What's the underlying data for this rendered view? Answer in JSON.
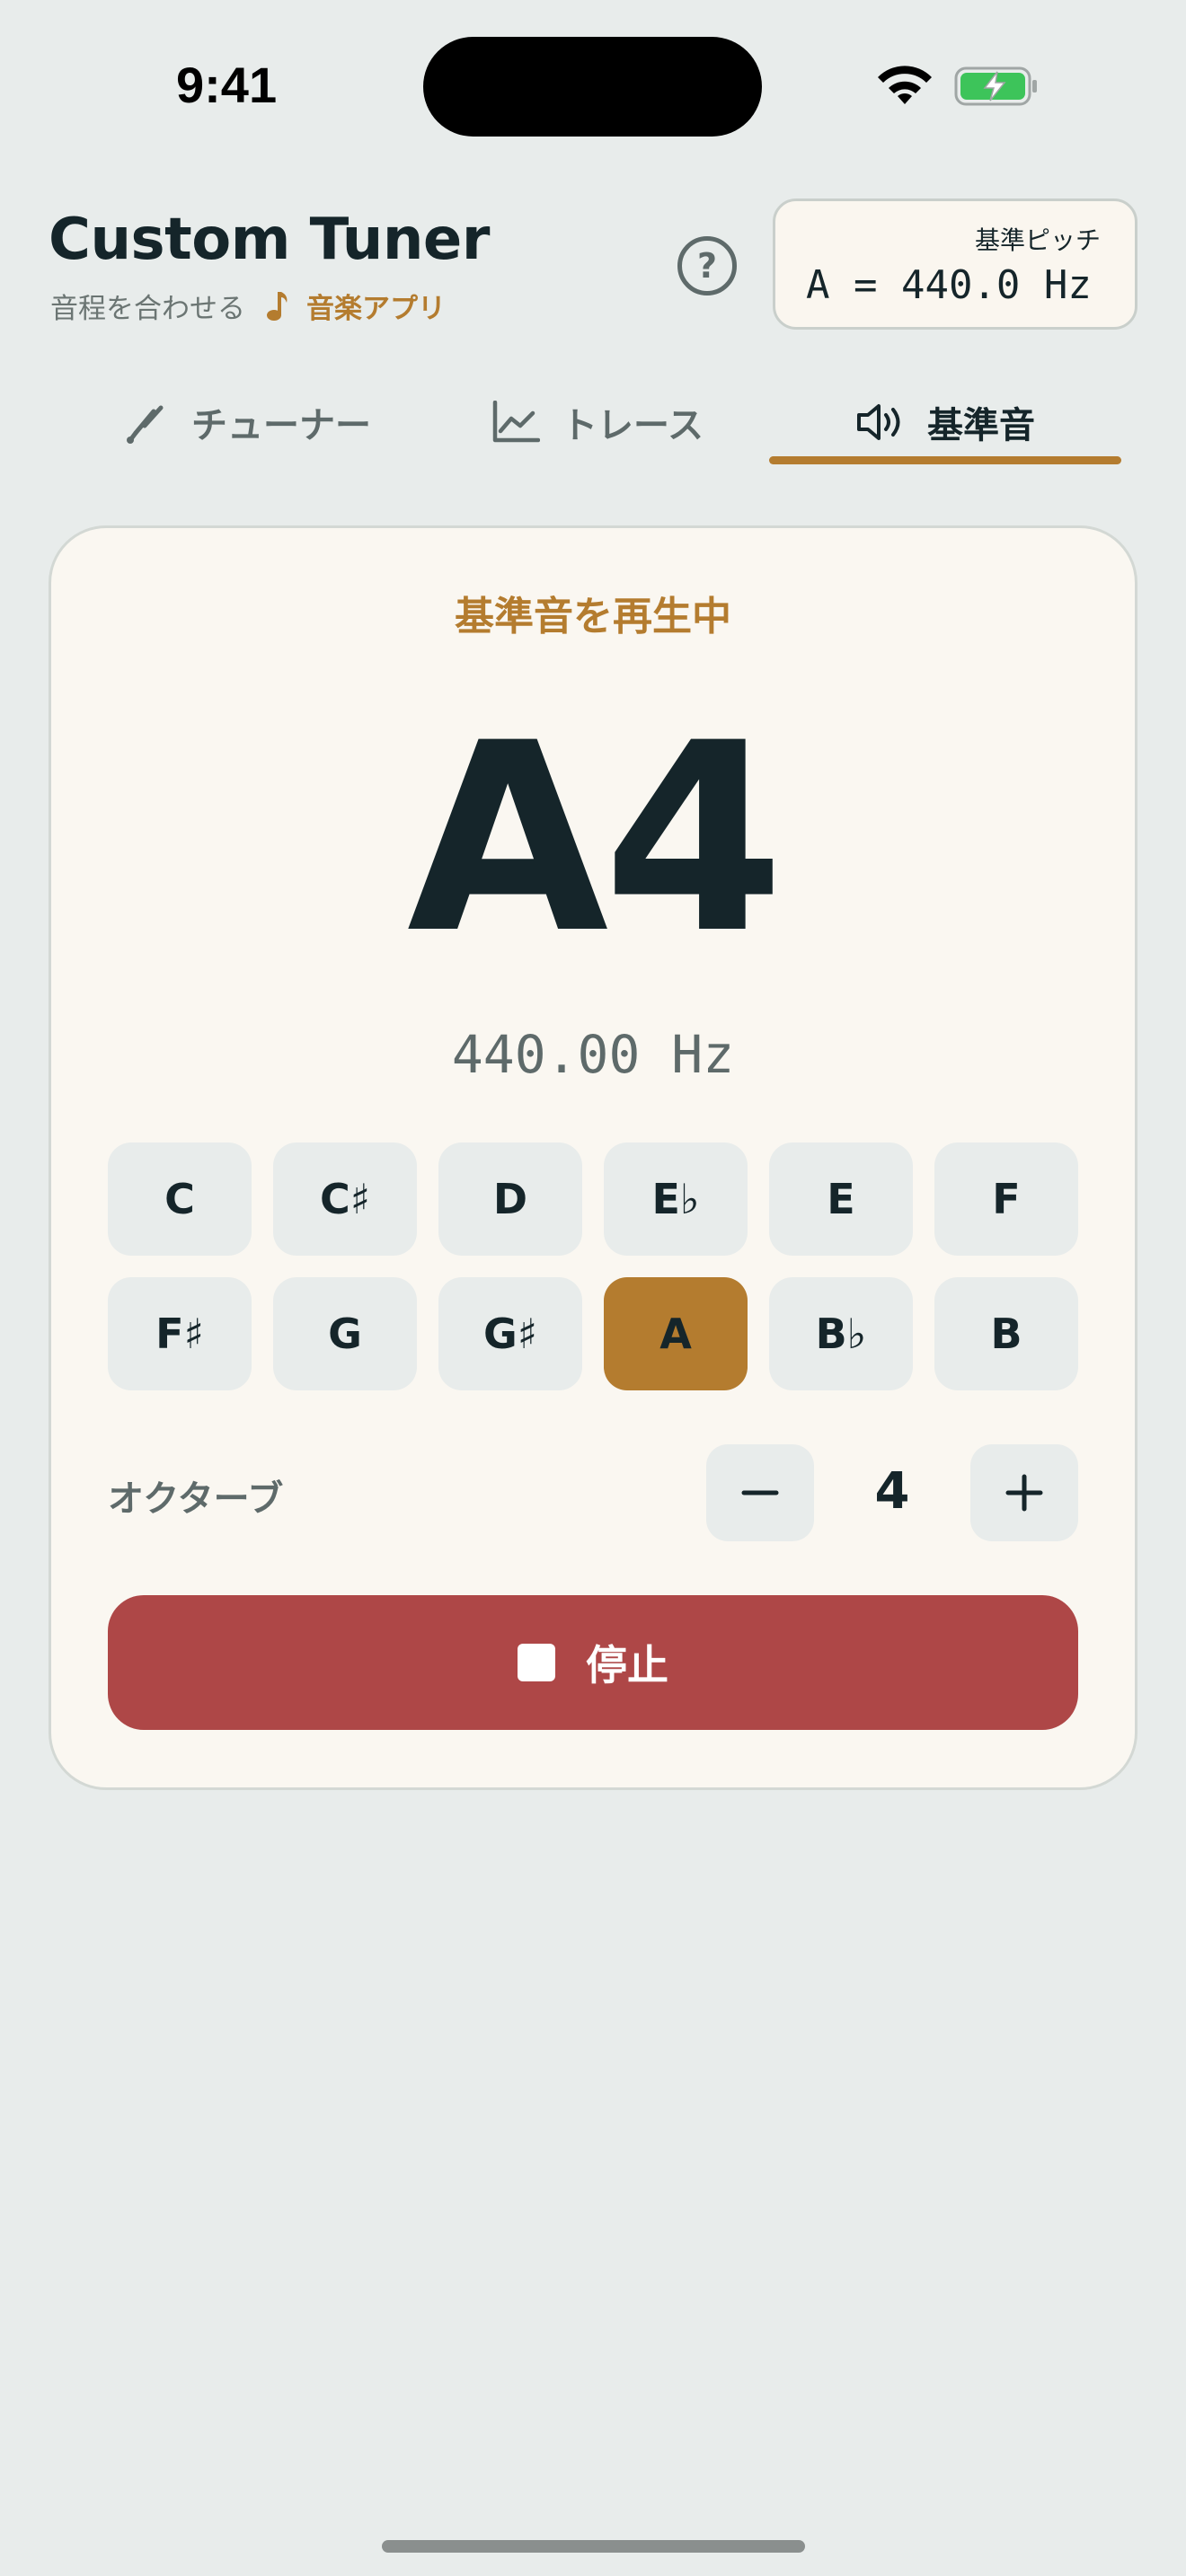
{
  "status_bar": {
    "time": "9:41"
  },
  "header": {
    "title": "Custom Tuner",
    "subtitle": "音程を合わせる",
    "category": "音楽アプリ",
    "help_label": "?"
  },
  "reference_pitch": {
    "label": "基準ピッチ",
    "value": "A = 440.0 Hz"
  },
  "tabs": [
    {
      "label": "チューナー",
      "icon": "tuning-fork-icon",
      "active": false
    },
    {
      "label": "トレース",
      "icon": "line-chart-icon",
      "active": false
    },
    {
      "label": "基準音",
      "icon": "speaker-icon",
      "active": true
    }
  ],
  "player": {
    "status": "基準音を再生中",
    "note": "A4",
    "frequency": "440.00 Hz",
    "notes": [
      "C",
      "C♯",
      "D",
      "E♭",
      "E",
      "F",
      "F♯",
      "G",
      "G♯",
      "A",
      "B♭",
      "B"
    ],
    "selected_note": "A",
    "octave_label": "オクターブ",
    "octave_value": "4",
    "stop_label": "停止"
  },
  "colors": {
    "accent": "#B47C2F",
    "stop": "#AE4747",
    "background": "#E8ECEB",
    "card": "#FAF7F1"
  }
}
